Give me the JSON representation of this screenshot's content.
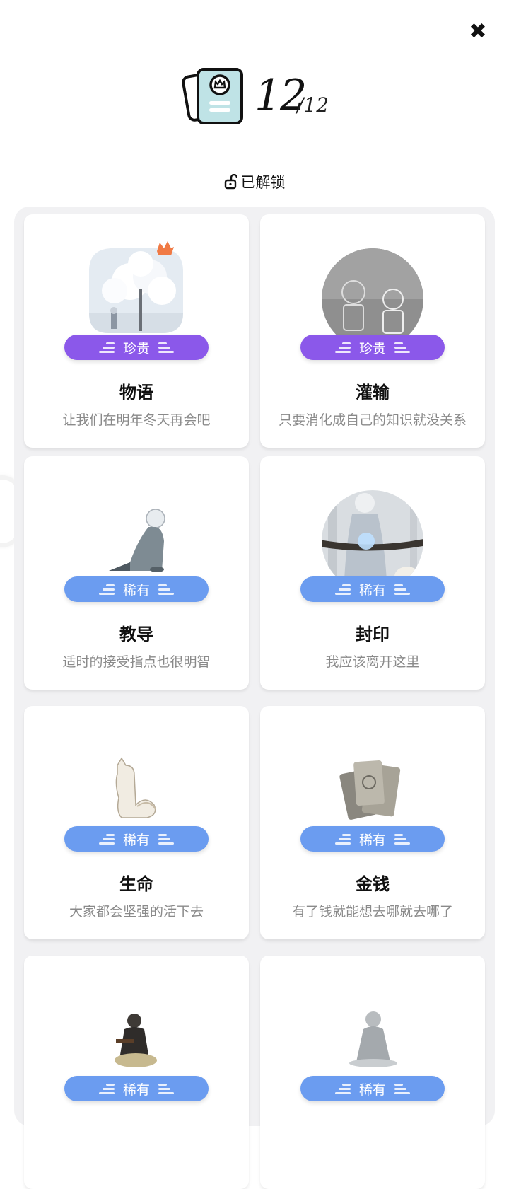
{
  "header": {
    "collected": "12",
    "total": "/12",
    "close_icon": "close-icon",
    "book_icon": "card-book-icon"
  },
  "section": {
    "label": "已解锁",
    "icon": "unlock-icon"
  },
  "colors": {
    "rare_precious": "#8b58ea",
    "rare": "#6b9cf0",
    "panel": "#f1f1f3"
  },
  "cards": [
    {
      "badge": "珍贵",
      "title": "物语",
      "desc": "让我们在明年冬天再会吧",
      "image": "snowy-tree-illustration"
    },
    {
      "badge": "珍贵",
      "title": "灌输",
      "desc": "只要消化成自己的知识就没关系",
      "image": "chalk-drawing-illustration"
    },
    {
      "badge": "稀有",
      "title": "教导",
      "desc": "适时的接受指点也很明智",
      "image": "kneeling-figure-illustration"
    },
    {
      "badge": "稀有",
      "title": "封印",
      "desc": "我应该离开这里",
      "image": "sealed-rope-illustration"
    },
    {
      "badge": "稀有",
      "title": "生命",
      "desc": "大家都会坚强的活下去",
      "image": "fox-illustration"
    },
    {
      "badge": "稀有",
      "title": "金钱",
      "desc": "有了钱就能想去哪就去哪了",
      "image": "coins-illustration"
    },
    {
      "badge": "稀有",
      "title": "",
      "desc": "",
      "image": "sitting-man-illustration"
    },
    {
      "badge": "稀有",
      "title": "",
      "desc": "",
      "image": "back-figure-illustration"
    }
  ]
}
